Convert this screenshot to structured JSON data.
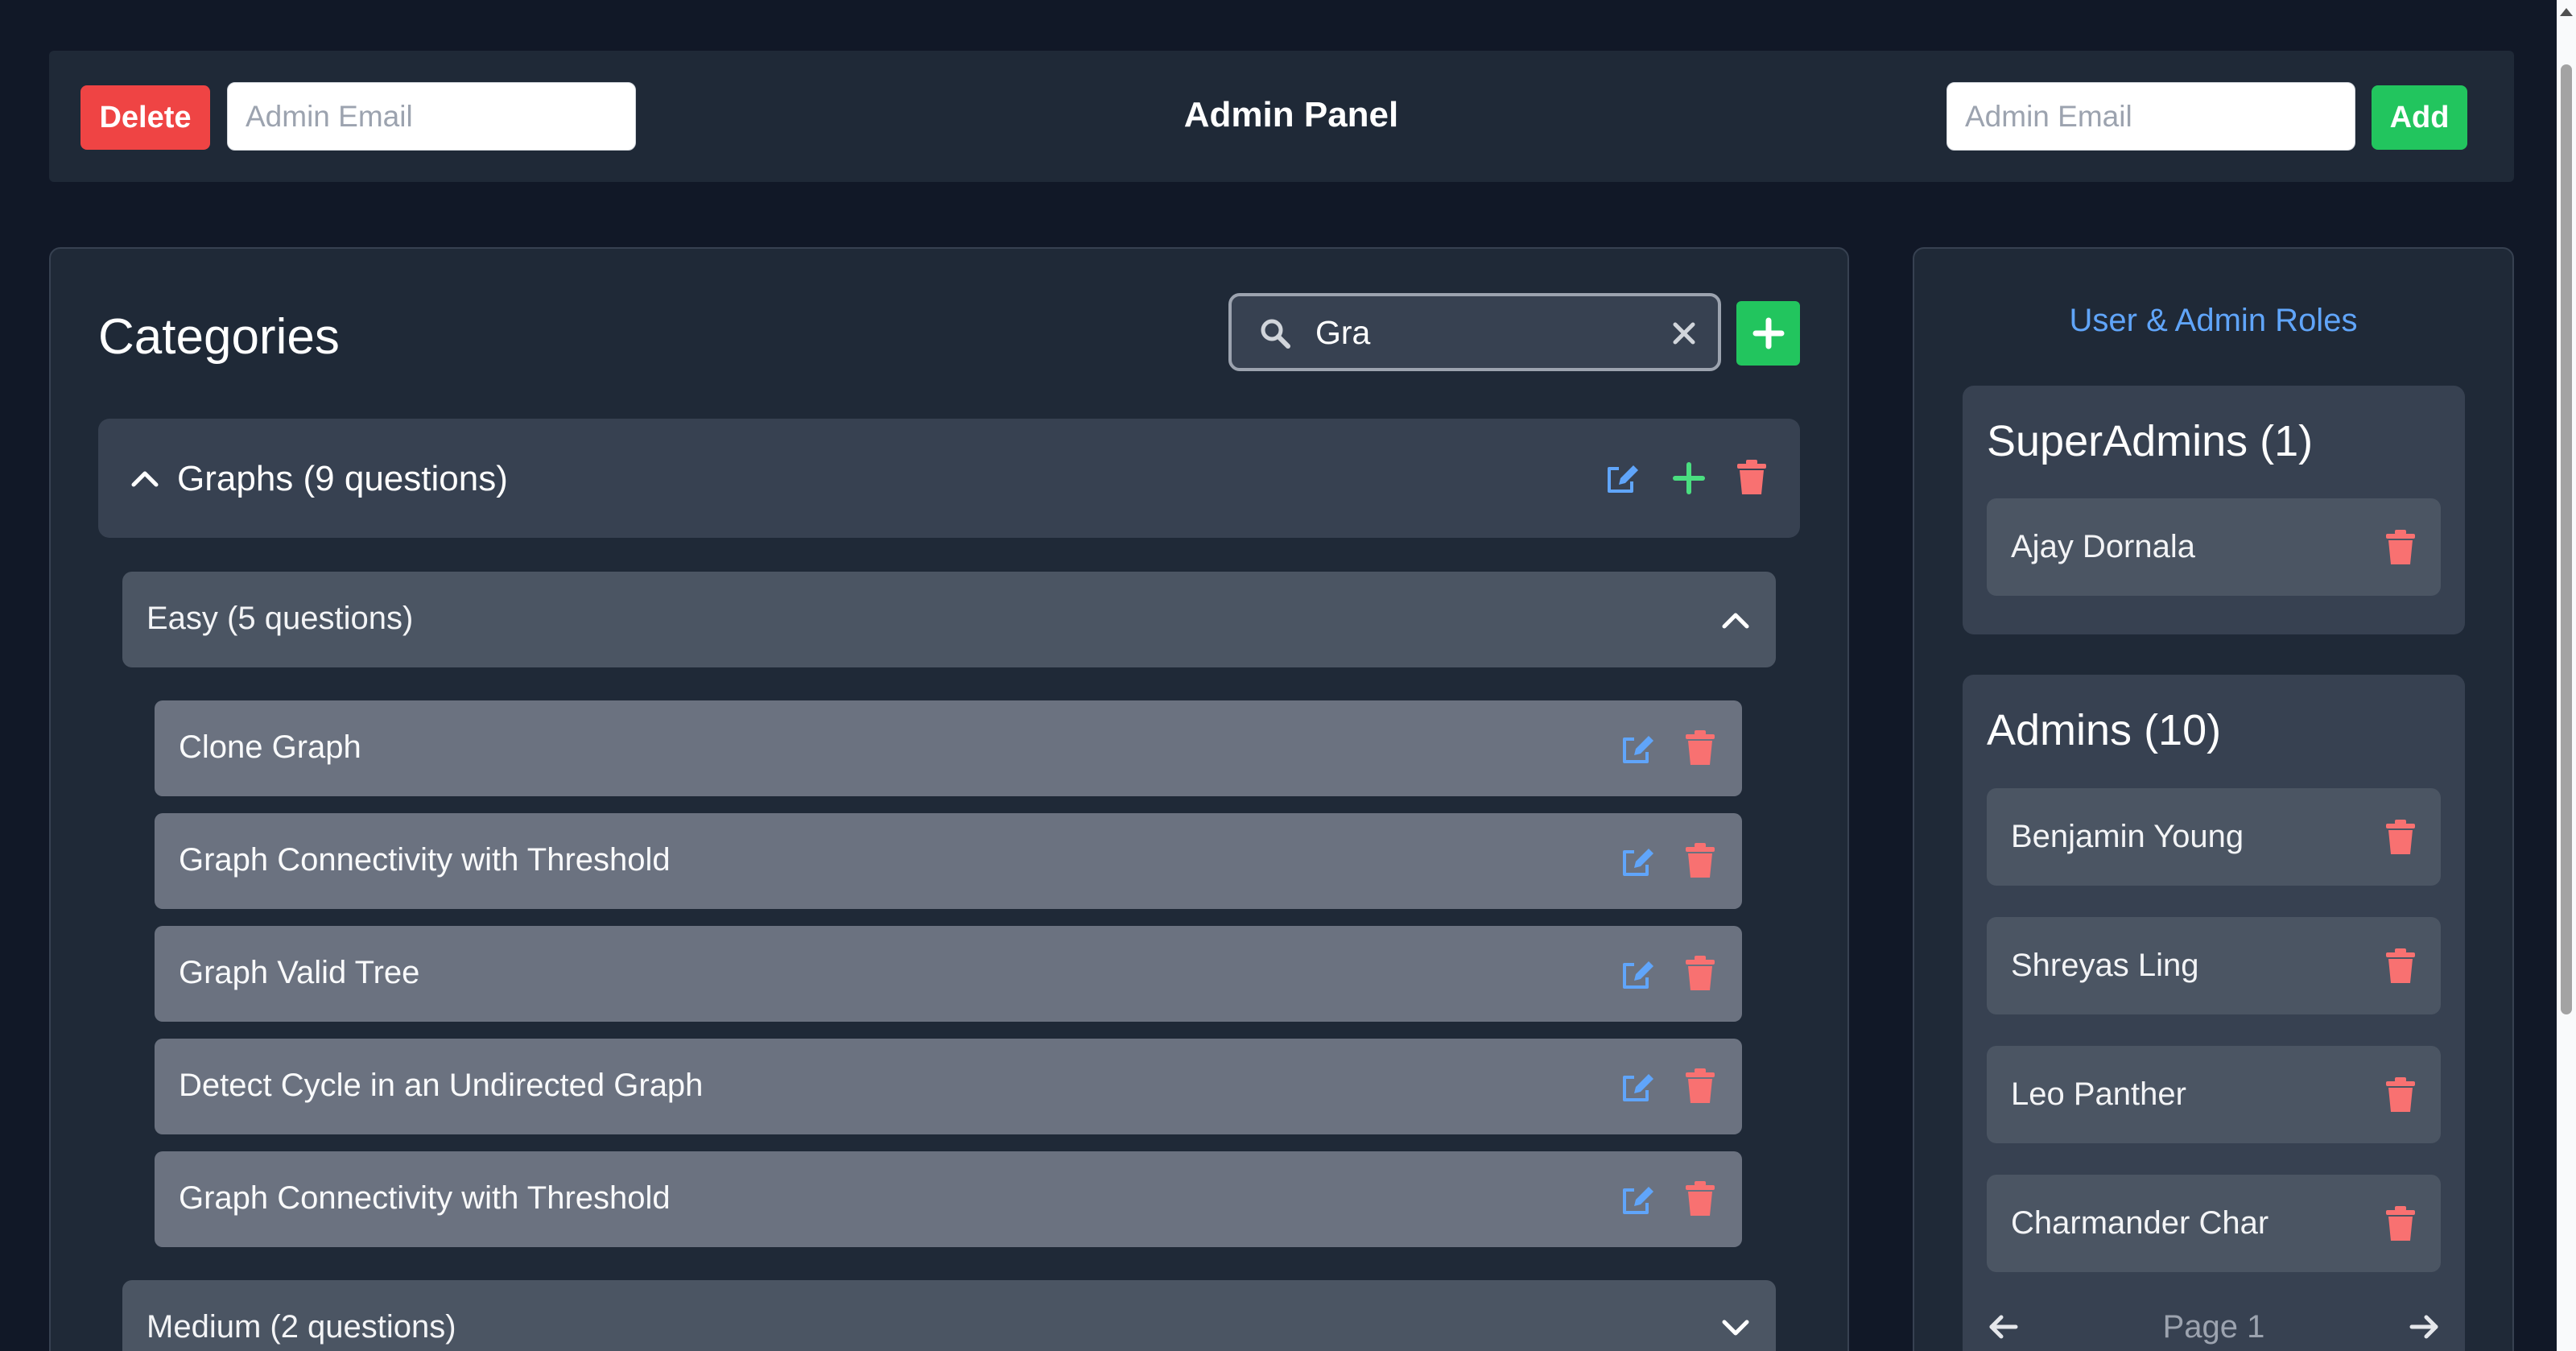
{
  "topbar": {
    "delete_label": "Delete",
    "delete_email_placeholder": "Admin Email",
    "title": "Admin Panel",
    "add_email_placeholder": "Admin Email",
    "add_label": "Add"
  },
  "categories": {
    "title": "Categories",
    "search_value": "Gra",
    "group": {
      "title": "Graphs (9 questions)",
      "difficulties": [
        {
          "label": "Easy (5 questions)",
          "expanded": true,
          "questions": [
            "Clone Graph",
            "Graph Connectivity with Threshold",
            "Graph Valid Tree",
            "Detect Cycle in an Undirected Graph",
            "Graph Connectivity with Threshold"
          ]
        },
        {
          "label": "Medium (2 questions)",
          "expanded": false
        }
      ]
    }
  },
  "roles": {
    "link_label": "User & Admin Roles",
    "superadmins": {
      "title": "SuperAdmins (1)",
      "members": [
        "Ajay Dornala"
      ]
    },
    "admins": {
      "title": "Admins (10)",
      "members": [
        "Benjamin Young",
        "Shreyas Ling",
        "Leo Panther",
        "Charmander Char"
      ]
    },
    "pagination": {
      "label": "Page 1"
    }
  },
  "colors": {
    "background": "#111827",
    "panel": "#1f2937",
    "danger": "#ef4444",
    "success": "#22c55e",
    "edit_icon": "#60a5fa",
    "delete_icon": "#f87171",
    "link": "#60a5fa"
  },
  "icons": {
    "search": "search-icon",
    "clear": "close-icon",
    "add": "plus-icon",
    "edit": "edit-icon",
    "delete": "trash-icon",
    "collapse": "chevron-up-icon",
    "expand": "chevron-down-icon",
    "prev": "arrow-left-icon",
    "next": "arrow-right-icon"
  }
}
